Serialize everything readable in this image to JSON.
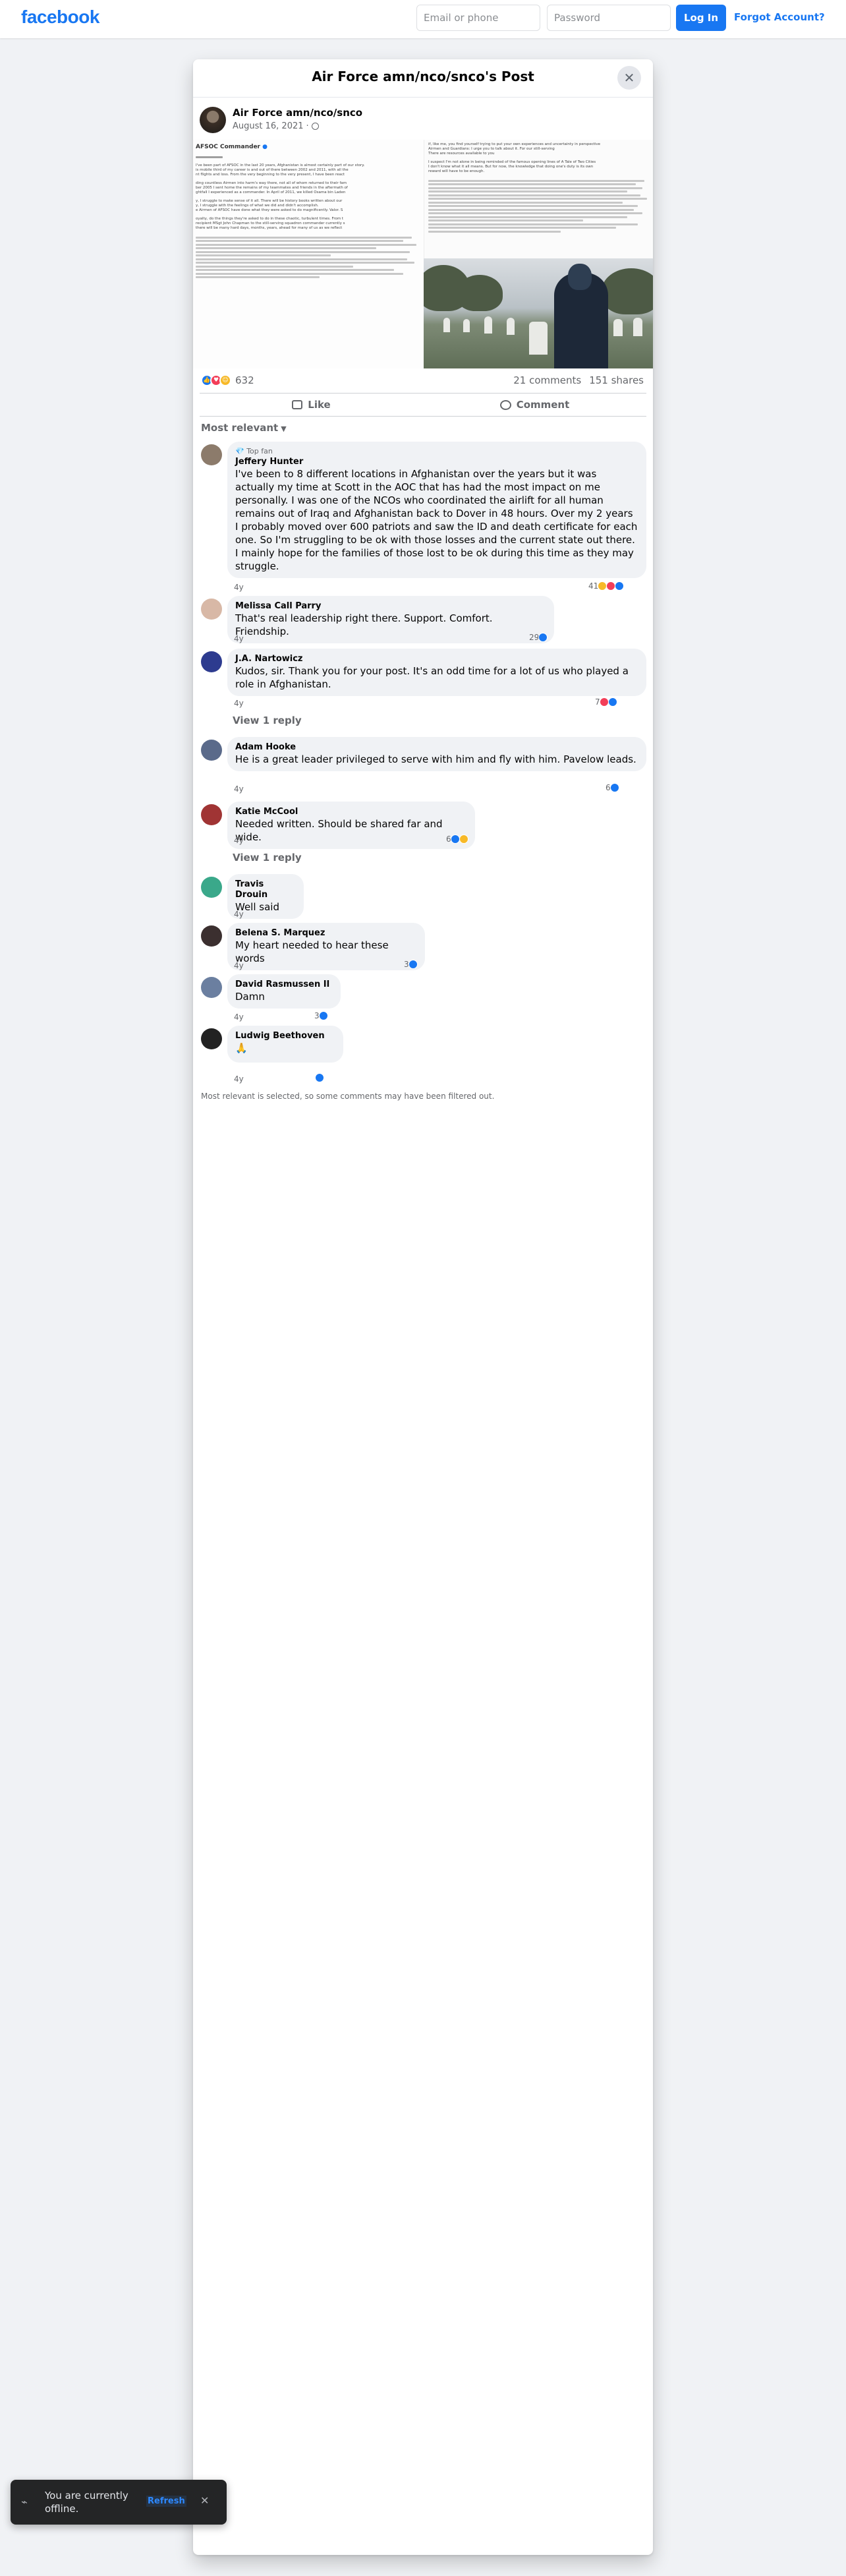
{
  "topbar": {
    "logo": "facebook",
    "email_placeholder": "Email or phone",
    "password_placeholder": "Password",
    "login_label": "Log In",
    "forgot_label": "Forgot Account?"
  },
  "modal": {
    "title": "Air Force amn/nco/snco's Post",
    "close_icon": "close-icon"
  },
  "post": {
    "author": "Air Force amn/nco/snco",
    "date": "August 16, 2021",
    "privacy_icon": "globe-icon",
    "image": {
      "letter_header": "AFSOC Commander",
      "left_snippets": [
        "I've been part of AFSOC in the last 20 years, Afghanistan is almost certainly part of our story.",
        "is mobile third of my career is and out of there between 2002 and 2011, with all the",
        "nt flights and loss. From the very beginning to the very present, I have been react",
        "ding countless Airmen into harm's way there, not all of whom returned to their fam",
        "ber 2005 I sent home the remains of my teammates and friends in the aftermath of",
        "ghtfall I experienced as a commander. In April of 2011, we killed Osama bin Laden",
        "y, I struggle to make sense of it all. There will be history books written about our",
        "y, I struggle with the feelings of what we did and didn't accomplish.",
        "e Airmen of AFSOC have done what they were asked to do magnificently. Valor. S",
        "oyalty, do the things they're asked to do in these chaotic, turbulent times. From t",
        "recipient MSgt John Chapman to the still-serving squadron commander currently s",
        "there will be many hard days, months, years, ahead for many of us as we reflect"
      ],
      "right_snippets": [
        "if, like me, you find yourself trying to put your own experiences and uncertainty in perspective",
        "Airmen and Guardians: I urge you to talk about it. For our still-serving",
        "There are resources available to you",
        "I suspect I'm not alone in being reminded of the famous opening lines of A Tale of Two Cities",
        "I don't know what it all means. But for now, the knowledge that doing one's duty is its own",
        "reward will have to be enough."
      ]
    },
    "reactions": {
      "icons": [
        "like-icon",
        "love-icon",
        "care-icon"
      ],
      "count": "632"
    },
    "comments_count": "21 comments",
    "shares_count": "151 shares",
    "like_label": "Like",
    "comment_label": "Comment"
  },
  "sort": {
    "label": "Most relevant"
  },
  "comments": [
    {
      "badge": "Top fan",
      "name": "Jeffery Hunter",
      "text": "I've been to 8 different locations in Afghanistan over the years but it was actually my time at Scott in the AOC that has had the most impact on me personally. I was one of the NCOs who coordinated the airlift for all human remains out of Iraq and Afghanistan back to Dover in 48 hours. Over my 2 years I probably moved over 600 patriots and saw the ID and death certificate for each one. So I'm struggling to be ok with those losses and the current state out there. I mainly hope for the families of those lost to be ok during this time as they may struggle.",
      "time": "4y",
      "reactions": "41"
    },
    {
      "name": "Melissa Call Parry",
      "text": "That's real leadership right there. Support. Comfort. Friendship.",
      "time": "4y",
      "reactions": "29"
    },
    {
      "name": "J.A. Nartowicz",
      "text": "Kudos, sir. Thank you for your post. It's an odd time for a lot of us who played a role in Afghanistan.",
      "time": "4y",
      "reactions": "7",
      "replies": "View 1 reply"
    },
    {
      "name": "Adam Hooke",
      "text": "He is a great leader privileged to serve with him and fly with him. Pavelow leads.",
      "time": "4y",
      "reactions": "6"
    },
    {
      "name": "Katie McCool",
      "text": "Needed written. Should be shared far and wide.",
      "time": "4y",
      "reactions": "6",
      "replies": "View 1 reply"
    },
    {
      "name": "Travis Drouin",
      "text": "Well said",
      "time": "4y"
    },
    {
      "name": "Belena S. Marquez",
      "text": "My heart needed to hear these words",
      "time": "4y",
      "reactions": "3"
    },
    {
      "name": "David Rasmussen II",
      "text": "Damn",
      "time": "4y",
      "reactions": "3"
    },
    {
      "name": "Ludwig Beethoven",
      "text": "🙏",
      "time": "4y"
    }
  ],
  "filter_note": "Most relevant is selected, so some comments may have been filtered out.",
  "toast": {
    "text": "You are currently offline.",
    "refresh_label": "Refresh",
    "icon": "wifi-off-icon"
  }
}
